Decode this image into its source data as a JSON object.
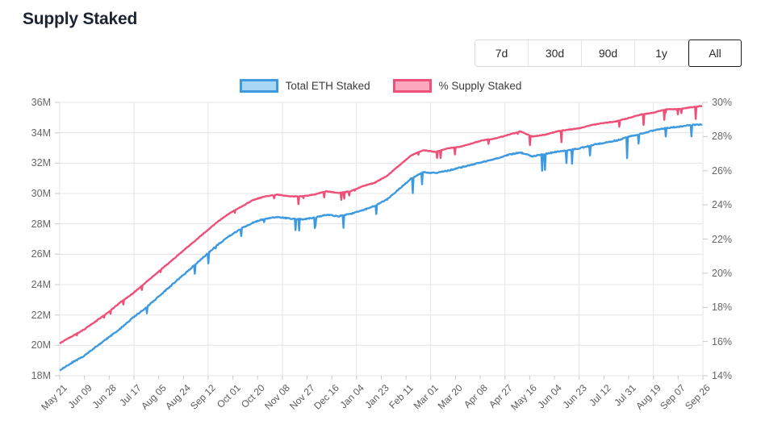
{
  "header": {
    "title": "Supply Staked"
  },
  "range_selector": {
    "options": [
      {
        "label": "7d",
        "selected": false
      },
      {
        "label": "30d",
        "selected": false
      },
      {
        "label": "90d",
        "selected": false
      },
      {
        "label": "1y",
        "selected": false
      },
      {
        "label": "All",
        "selected": true
      }
    ]
  },
  "colors": {
    "blue_line": "#3d9ae0",
    "blue_fill": "#a8d6f5",
    "pink_line": "#ef5079",
    "pink_fill": "#fba7bd",
    "grid": "#e4e4e4",
    "axis_text": "#666666",
    "title": "#1b2430",
    "selected_border": "#1b1b1b"
  },
  "chart_data": {
    "type": "line",
    "title": "Supply Staked",
    "xlabel": "",
    "ylabel": "Total ETH Staked",
    "y2label": "% Supply Staked",
    "grid": true,
    "legend_position": "top-center",
    "ylim": [
      18000000,
      36000000
    ],
    "y2lim": [
      14,
      30
    ],
    "ytick_labels": [
      "18M",
      "20M",
      "22M",
      "24M",
      "26M",
      "28M",
      "30M",
      "32M",
      "34M",
      "36M"
    ],
    "ytick_values": [
      18000000,
      20000000,
      22000000,
      24000000,
      26000000,
      28000000,
      30000000,
      32000000,
      34000000,
      36000000
    ],
    "y2tick_labels": [
      "14%",
      "16%",
      "18%",
      "20%",
      "22%",
      "24%",
      "26%",
      "28%",
      "30%"
    ],
    "y2tick_values": [
      14,
      16,
      18,
      20,
      22,
      24,
      26,
      28,
      30
    ],
    "xtick_labels": [
      "May 21",
      "Jun 09",
      "Jun 28",
      "Jul 17",
      "Aug 05",
      "Aug 24",
      "Sep 12",
      "Oct 01",
      "Oct 20",
      "Nov 08",
      "Nov 27",
      "Dec 16",
      "Jan 04",
      "Jan 23",
      "Feb 11",
      "Mar 01",
      "Mar 20",
      "Apr 08",
      "Apr 27",
      "May 16",
      "Jun 04",
      "Jun 23",
      "Jul 12",
      "Jul 31",
      "Aug 19",
      "Sep 07",
      "Sep 26"
    ],
    "series": [
      {
        "name": "Total ETH Staked",
        "axis": "left",
        "color": "#3d9ae0",
        "x": [
          "May 21",
          "May 30",
          "Jun 09",
          "Jun 18",
          "Jun 28",
          "Jul 08",
          "Jul 17",
          "Jul 26",
          "Aug 05",
          "Aug 14",
          "Aug 24",
          "Sep 02",
          "Sep 12",
          "Sep 21",
          "Oct 01",
          "Oct 10",
          "Oct 20",
          "Oct 29",
          "Nov 08",
          "Nov 17",
          "Nov 27",
          "Dec 06",
          "Dec 16",
          "Dec 25",
          "Jan 04",
          "Jan 13",
          "Jan 23",
          "Feb 01",
          "Feb 11",
          "Feb 20",
          "Mar 01",
          "Mar 10",
          "Mar 20",
          "Mar 29",
          "Apr 08",
          "Apr 17",
          "Apr 27",
          "May 06",
          "May 16",
          "May 25",
          "Jun 04",
          "Jun 13",
          "Jun 23",
          "Jul 02",
          "Jul 12",
          "Jul 21",
          "Jul 31",
          "Aug 09",
          "Aug 19",
          "Aug 28",
          "Sep 07",
          "Sep 16",
          "Sep 26",
          "Oct 03"
        ],
        "values": [
          18350000,
          18850000,
          19300000,
          19900000,
          20500000,
          21100000,
          21800000,
          22400000,
          23100000,
          23800000,
          24500000,
          25200000,
          25900000,
          26600000,
          27200000,
          27700000,
          28100000,
          28350000,
          28450000,
          28350000,
          28300000,
          28400000,
          28600000,
          28500000,
          28650000,
          28900000,
          29200000,
          29600000,
          30300000,
          31000000,
          31400000,
          31350000,
          31500000,
          31700000,
          31900000,
          32100000,
          32300000,
          32550000,
          32700000,
          32450000,
          32600000,
          32750000,
          32850000,
          33000000,
          33200000,
          33350000,
          33500000,
          33750000,
          33950000,
          34150000,
          34300000,
          34400000,
          34500000,
          34550000
        ]
      },
      {
        "name": "% Supply Staked",
        "axis": "right",
        "color": "#ef5079",
        "x": [
          "May 21",
          "May 30",
          "Jun 09",
          "Jun 18",
          "Jun 28",
          "Jul 08",
          "Jul 17",
          "Jul 26",
          "Aug 05",
          "Aug 14",
          "Aug 24",
          "Sep 02",
          "Sep 12",
          "Sep 21",
          "Oct 01",
          "Oct 10",
          "Oct 20",
          "Oct 29",
          "Nov 08",
          "Nov 17",
          "Nov 27",
          "Dec 06",
          "Dec 16",
          "Dec 25",
          "Jan 04",
          "Jan 13",
          "Jan 23",
          "Feb 01",
          "Feb 11",
          "Feb 20",
          "Mar 01",
          "Mar 10",
          "Mar 20",
          "Mar 29",
          "Apr 08",
          "Apr 17",
          "Apr 27",
          "May 06",
          "May 16",
          "May 25",
          "Jun 04",
          "Jun 13",
          "Jun 23",
          "Jul 02",
          "Jul 12",
          "Jul 21",
          "Jul 31",
          "Aug 09",
          "Aug 19",
          "Aug 28",
          "Sep 07",
          "Sep 16",
          "Sep 26",
          "Oct 03"
        ],
        "values": [
          15.9,
          16.3,
          16.7,
          17.2,
          17.7,
          18.3,
          18.8,
          19.4,
          20.0,
          20.6,
          21.2,
          21.8,
          22.4,
          23.0,
          23.5,
          23.9,
          24.3,
          24.5,
          24.6,
          24.5,
          24.5,
          24.6,
          24.8,
          24.7,
          24.8,
          25.1,
          25.3,
          25.7,
          26.3,
          26.9,
          27.2,
          27.1,
          27.3,
          27.4,
          27.6,
          27.8,
          27.9,
          28.1,
          28.3,
          28.0,
          28.1,
          28.3,
          28.4,
          28.5,
          28.7,
          28.8,
          28.9,
          29.1,
          29.3,
          29.4,
          29.6,
          29.6,
          29.7,
          29.8
        ]
      }
    ],
    "annotations": "Both series rise steadily from May 21 with frequent short downward spikes; plateau near 28M (24.5%) around Oct-Jan, a step up near Feb-Mar to ~31.5M (27%), then a gradual climb to ~34.5M at the right edge."
  }
}
